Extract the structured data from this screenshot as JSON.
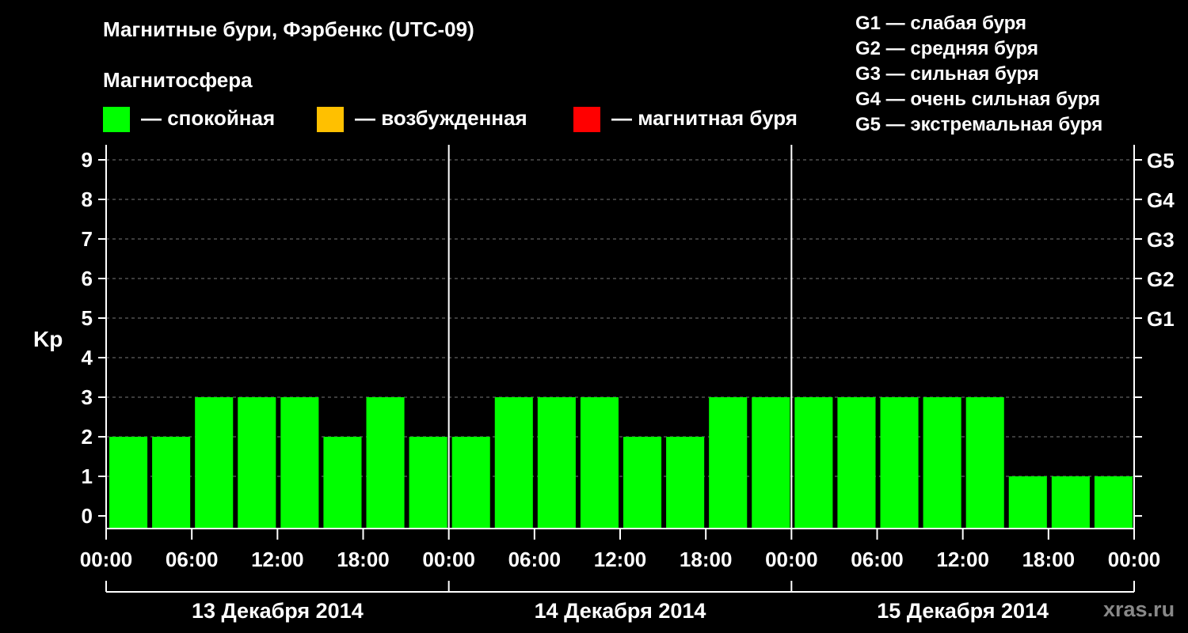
{
  "title": "Магнитные бури, Фэрбенкс (UTC-09)",
  "magnetosphere": {
    "label": "Магнитосфера",
    "legend": [
      {
        "label": "— спокойная",
        "color": "#00ff00"
      },
      {
        "label": "— возбужденная",
        "color": "#ffc000"
      },
      {
        "label": "— магнитная буря",
        "color": "#ff0000"
      }
    ]
  },
  "storm_levels": [
    "G1 — слабая буря",
    "G2 — средняя буря",
    "G3 — сильная буря",
    "G4 — очень сильная буря",
    "G5 — экстремальная буря"
  ],
  "brand": "xras.ru",
  "chart_data": {
    "type": "bar",
    "ylabel": "Kp",
    "ylim": [
      0,
      9
    ],
    "yticks": [
      "0",
      "1",
      "2",
      "3",
      "4",
      "5",
      "6",
      "7",
      "8",
      "9"
    ],
    "right_ticks": [
      {
        "kp": 5,
        "label": "G1"
      },
      {
        "kp": 6,
        "label": "G2"
      },
      {
        "kp": 7,
        "label": "G3"
      },
      {
        "kp": 8,
        "label": "G4"
      },
      {
        "kp": 9,
        "label": "G5"
      }
    ],
    "xticks": [
      "00:00",
      "06:00",
      "12:00",
      "18:00",
      "00:00",
      "06:00",
      "12:00",
      "18:00",
      "00:00",
      "06:00",
      "12:00",
      "18:00",
      "00:00"
    ],
    "days": [
      "13 Декабря 2014",
      "14 Декабря 2014",
      "15 Декабря 2014"
    ],
    "interval_hours": 3,
    "values": [
      2,
      2,
      3,
      3,
      3,
      2,
      3,
      2,
      2,
      3,
      3,
      3,
      2,
      2,
      3,
      3,
      3,
      3,
      3,
      3,
      3,
      1,
      1,
      1
    ],
    "bar_color": "#00ff00",
    "grid": "dashed horizontal"
  }
}
